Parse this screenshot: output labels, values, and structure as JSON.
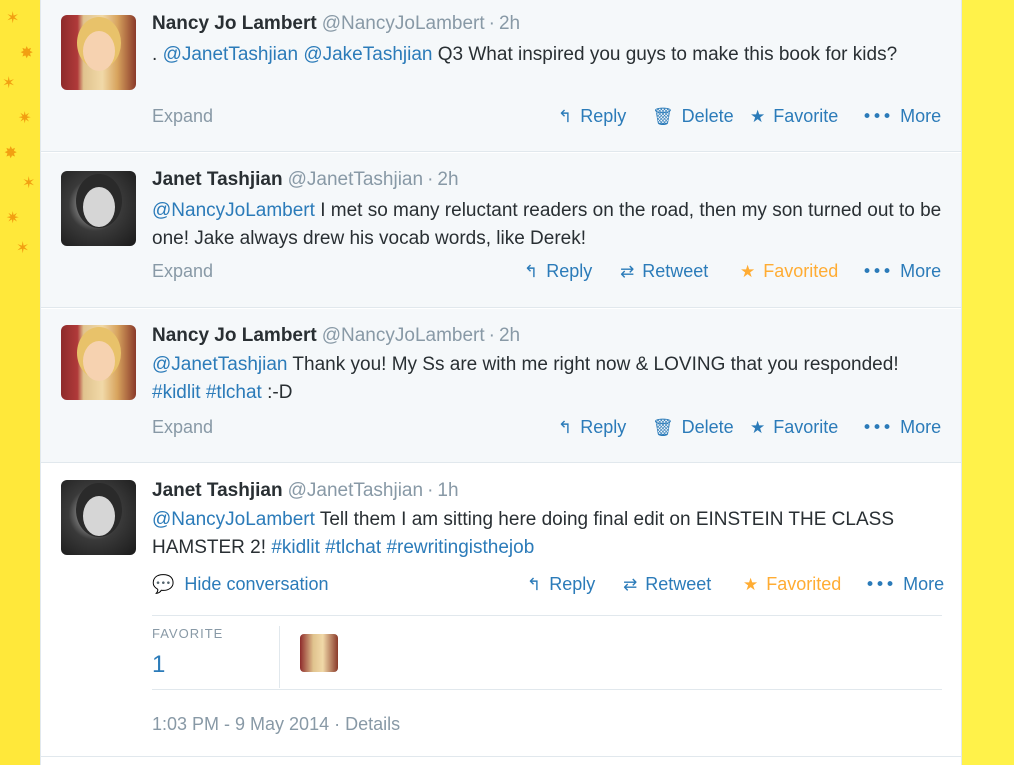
{
  "tweets": [
    {
      "fullname": "Nancy Jo Lambert",
      "username": "@NancyJoLambert",
      "separator": "·",
      "time": "2h",
      "text_prefix": ". ",
      "mention1": "@JanetTashjian",
      "mention2": "@JakeTashjian",
      "text_body": " Q3 What inspired you guys to make this book for kids?",
      "expand": "Expand",
      "actions": {
        "reply": "Reply",
        "delete": "Delete",
        "favorite": "Favorite",
        "more": "More"
      }
    },
    {
      "fullname": "Janet Tashjian",
      "username": "@JanetTashjian",
      "separator": "·",
      "time": "2h",
      "mention1": "@NancyJoLambert",
      "text_body": " I met so many reluctant readers on the road, then my son turned out to be one! Jake always drew his vocab words, like Derek!",
      "expand": "Expand",
      "actions": {
        "reply": "Reply",
        "retweet": "Retweet",
        "favorited": "Favorited",
        "more": "More"
      }
    },
    {
      "fullname": "Nancy Jo Lambert",
      "username": "@NancyJoLambert",
      "separator": "·",
      "time": "2h",
      "mention1": "@JanetTashjian",
      "text_body": " Thank you! My Ss are with me right now & LOVING that you responded! ",
      "hashtag1": "#kidlit",
      "hashtag2": "#tlchat",
      "text_tail": " :-D",
      "expand": "Expand",
      "actions": {
        "reply": "Reply",
        "delete": "Delete",
        "favorite": "Favorite",
        "more": "More"
      }
    },
    {
      "fullname": "Janet Tashjian",
      "username": "@JanetTashjian",
      "separator": "·",
      "time": "1h",
      "mention1": "@NancyJoLambert",
      "text_body": " Tell them I am sitting here doing final edit on EINSTEIN THE CLASS HAMSTER 2! ",
      "hashtag1": "#kidlit",
      "hashtag2": "#tlchat",
      "hashtag3": "#rewritingisthejob",
      "hide_conversation": "Hide conversation",
      "actions": {
        "reply": "Reply",
        "retweet": "Retweet",
        "favorited": "Favorited",
        "more": "More"
      },
      "stats": {
        "favorite_label": "FAVORITE",
        "favorite_count": "1"
      },
      "timestamp": "1:03 PM - 9 May 2014",
      "details": "Details"
    }
  ],
  "icons": {
    "reply": "reply-icon",
    "delete": "trash-icon",
    "favorite": "star-icon",
    "retweet": "retweet-icon",
    "more": "more-dots-icon",
    "conversation": "speech-bubble-icon"
  },
  "colors": {
    "link": "#2b7bb9",
    "favorited": "#ffac33",
    "muted": "#8899a6",
    "text": "#292f33",
    "page_background": "#fff24a"
  }
}
